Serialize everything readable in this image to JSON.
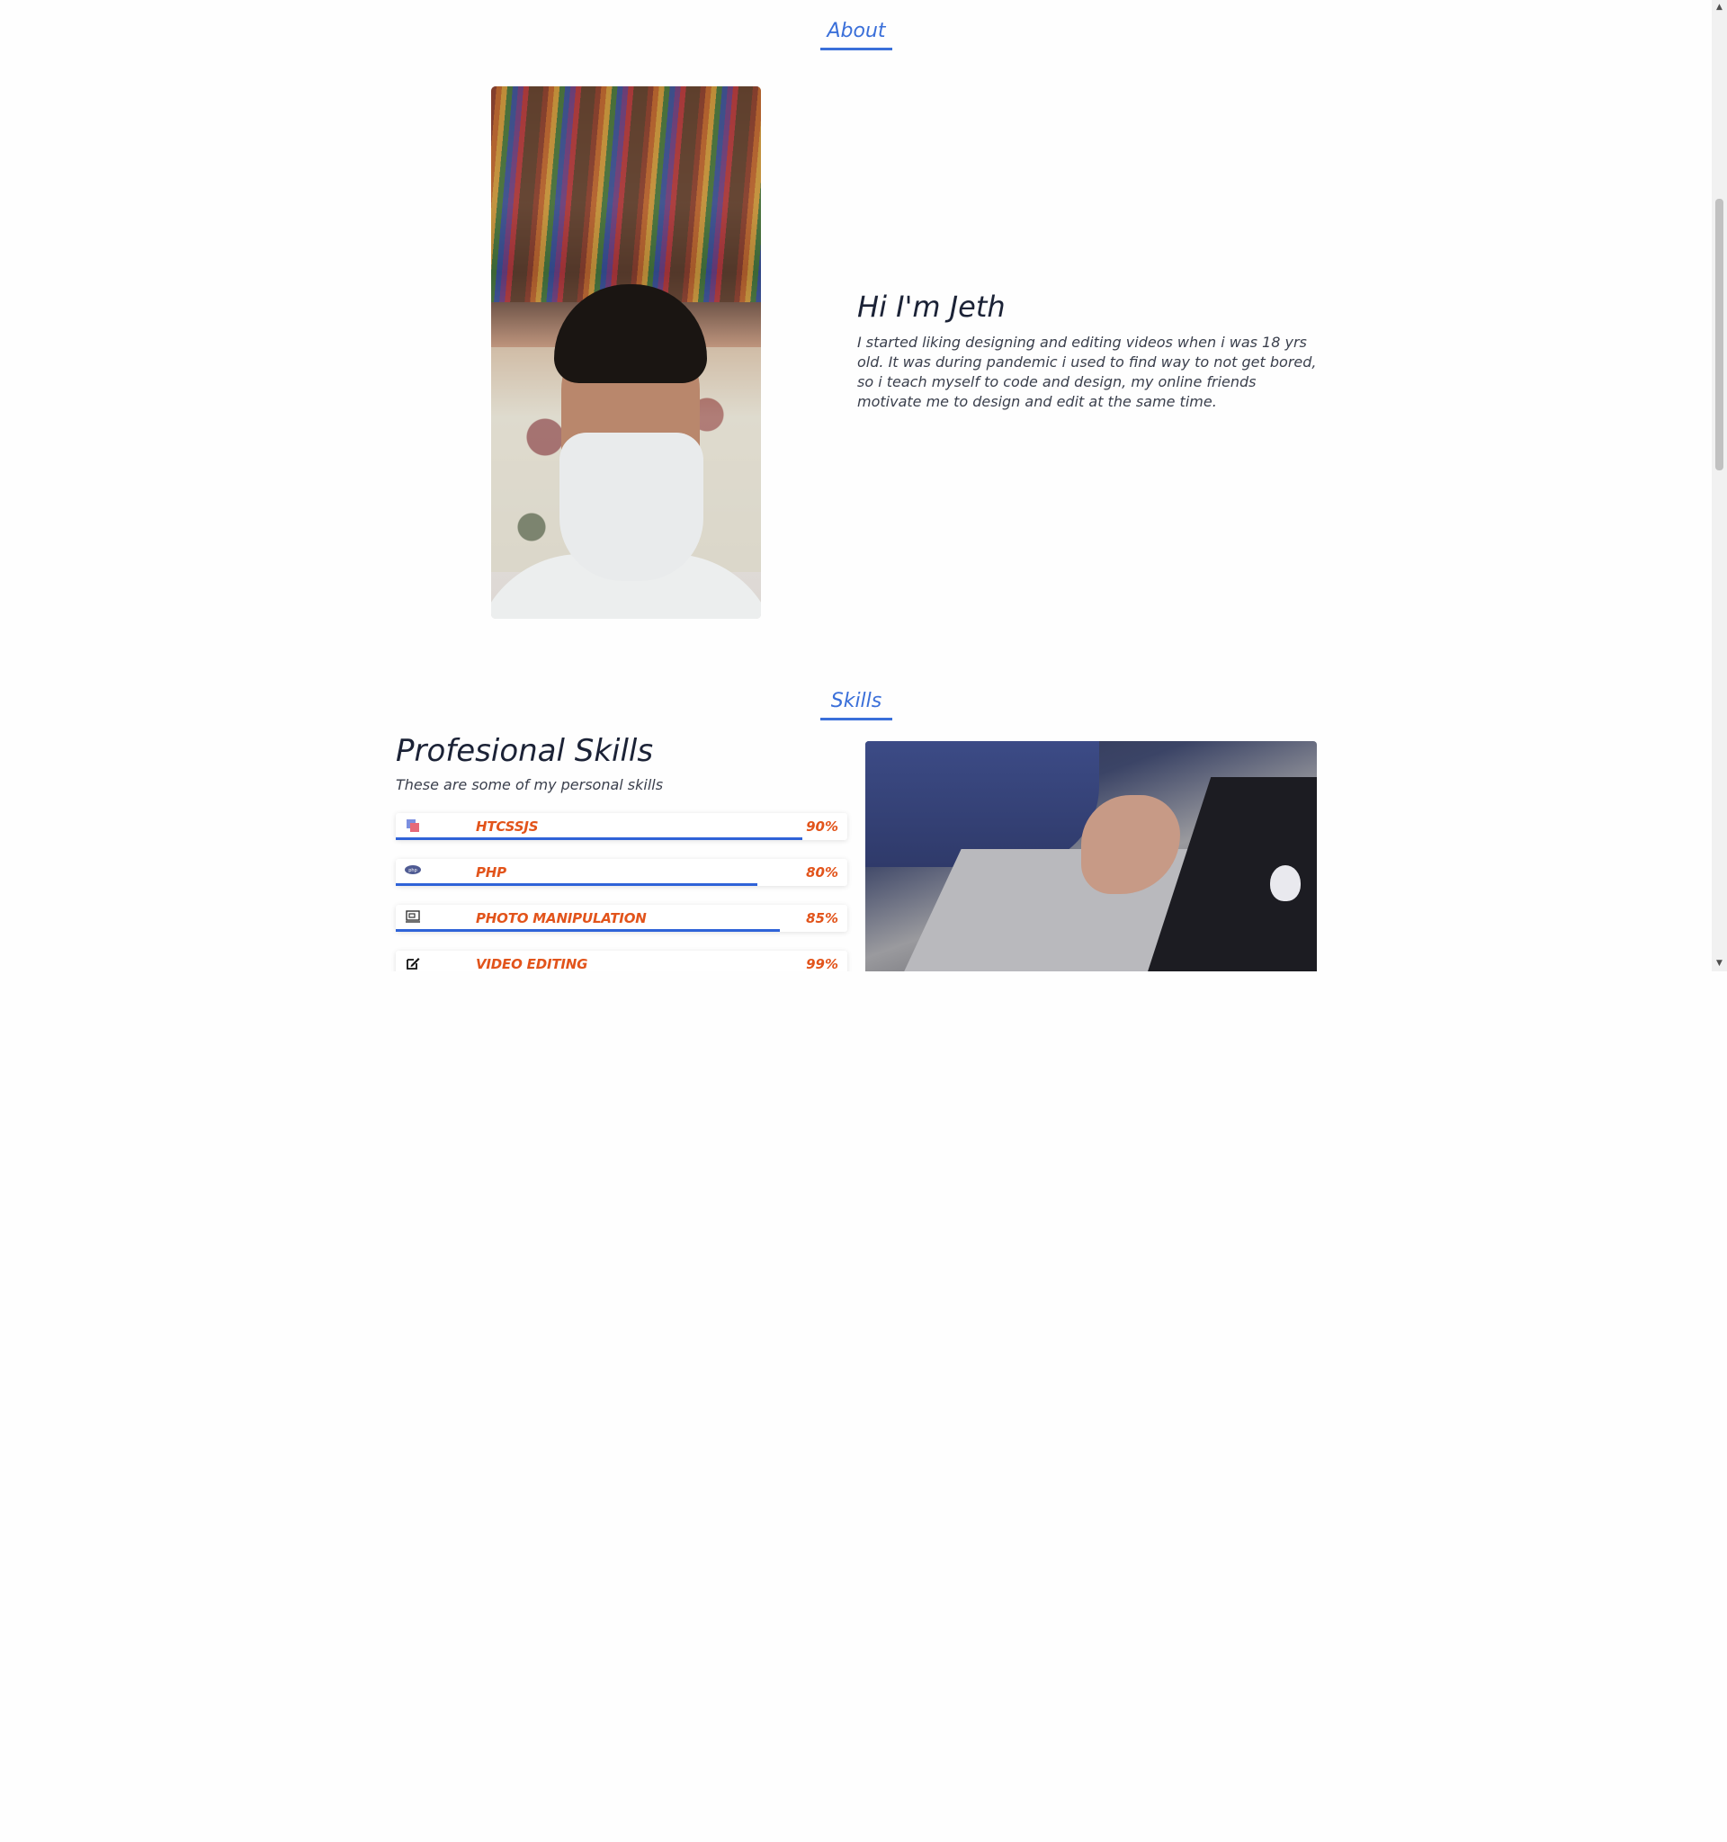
{
  "about": {
    "section_title": "About",
    "heading": "Hi I'm Jeth",
    "text": "I started liking designing and editing videos when i was 18 yrs old. It was during pandemic i used to find way to not get bored, so i teach myself to code and design, my online friends motivate me to design and edit at the same time."
  },
  "skills": {
    "section_title": "Skills",
    "heading": "Profesional Skills",
    "subheading": "These are some of my personal skills",
    "items": [
      {
        "name": "HTCSSJS",
        "percent_label": "90%",
        "level": 0.9,
        "icon": "html-css-icon"
      },
      {
        "name": "PHP",
        "percent_label": "80%",
        "level": 0.8,
        "icon": "php-icon"
      },
      {
        "name": "PHOTO MANIPULATION",
        "percent_label": "85%",
        "level": 0.85,
        "icon": "image-edit-icon"
      },
      {
        "name": "VIDEO EDITING",
        "percent_label": "99%",
        "level": 0.99,
        "icon": "pencil-edit-icon"
      }
    ]
  },
  "colors": {
    "accent": "#3a6fd9",
    "skill_label": "#e2541b",
    "bar": "#2f63d8"
  }
}
